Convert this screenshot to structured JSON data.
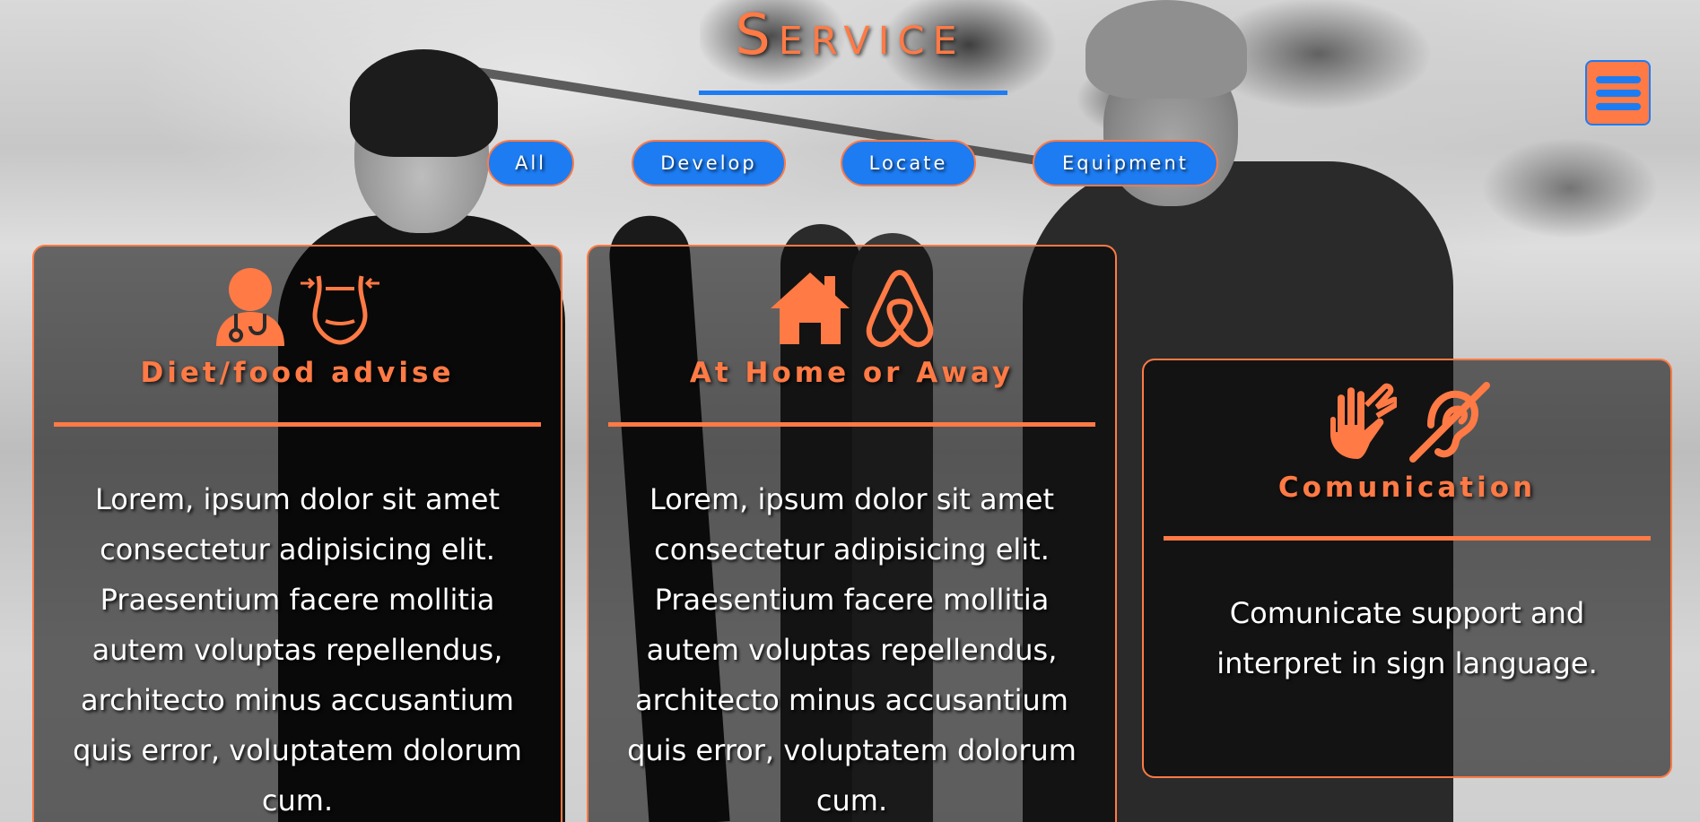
{
  "page": {
    "title": "Service"
  },
  "colors": {
    "accent": "#ff7a45",
    "primary": "#1d7cf2",
    "card_text": "#ffffff"
  },
  "menu": {
    "icon": "hamburger-menu-icon"
  },
  "filters": [
    {
      "label": "All"
    },
    {
      "label": "Develop"
    },
    {
      "label": "Locate"
    },
    {
      "label": "Equipment"
    }
  ],
  "cards": [
    {
      "icons": [
        "doctor-icon",
        "waist-measure-icon"
      ],
      "title": "Diet/food advise",
      "body": "Lorem, ipsum dolor sit amet consectetur adipisicing elit. Praesentium facere mollitia autem voluptas repellendus, architecto minus accusantium quis error, voluptatem dolorum cum."
    },
    {
      "icons": [
        "home-icon",
        "airbnb-icon"
      ],
      "title": "At Home or Away",
      "body": "Lorem, ipsum dolor sit amet consectetur adipisicing elit. Praesentium facere mollitia autem voluptas repellendus, architecto minus accusantium quis error, voluptatem dolorum cum."
    },
    {
      "icons": [
        "sign-language-icon",
        "deaf-icon"
      ],
      "title": "Comunication",
      "body": "Comunicate support and interpret in sign language."
    }
  ]
}
